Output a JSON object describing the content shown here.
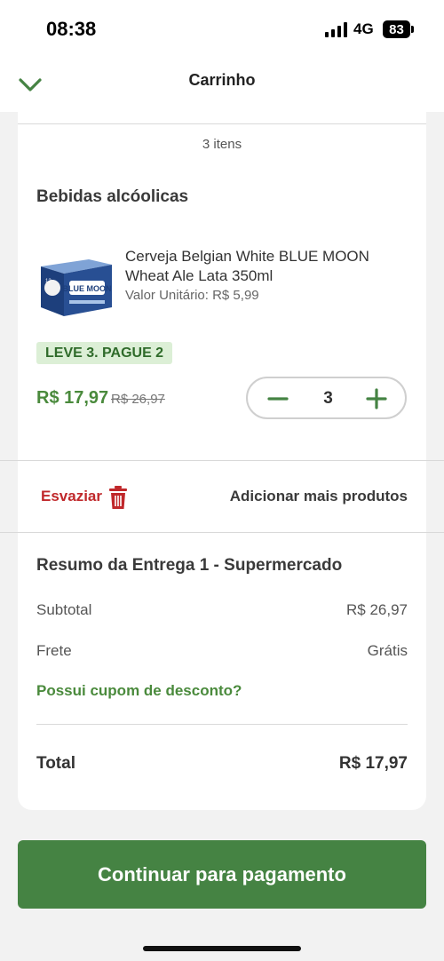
{
  "status_bar": {
    "time": "08:38",
    "network": "4G",
    "battery": "83"
  },
  "header": {
    "title": "Carrinho",
    "collapse_icon": "chevron-down-icon"
  },
  "cart": {
    "items_count": "3 itens",
    "section_title": "Bebidas alcóolicas",
    "product": {
      "name": "Cerveja Belgian White BLUE MOON Wheat Ale Lata 350ml",
      "unit_price": "Valor Unitário: R$ 5,99",
      "promo": "LEVE 3. PAGUE 2",
      "price_current": "R$ 17,97",
      "price_old": "R$ 26,97",
      "quantity": "3"
    },
    "empty_label": "Esvaziar",
    "add_more_label": "Adicionar mais produtos"
  },
  "summary": {
    "title": "Resumo da Entrega 1 - Supermercado",
    "subtotal_label": "Subtotal",
    "subtotal_value": "R$ 26,97",
    "shipping_label": "Frete",
    "shipping_value": "Grátis",
    "coupon_label": "Possui cupom de desconto?",
    "total_label": "Total",
    "total_value": "R$ 17,97"
  },
  "checkout_label": "Continuar para pagamento",
  "colors": {
    "accent_green": "#458343",
    "price_green": "#4a8a3c",
    "danger_red": "#c0282b",
    "promo_bg": "#dcefd6"
  }
}
